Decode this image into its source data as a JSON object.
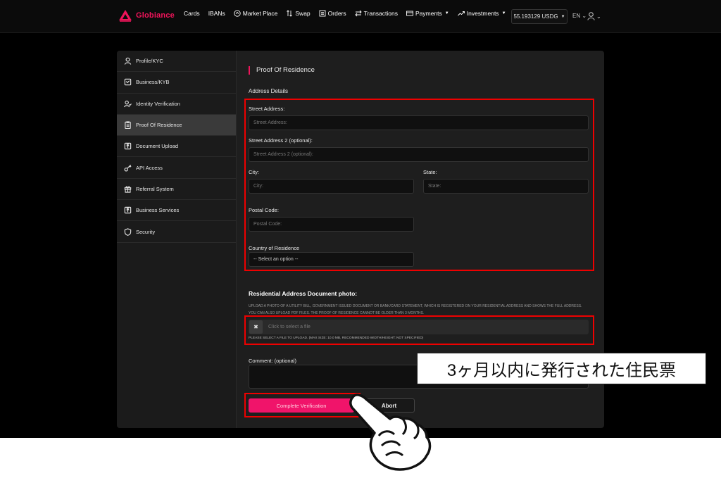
{
  "brand": {
    "name": "Globiance",
    "accent": "#f0145a"
  },
  "nav": {
    "items": [
      {
        "label": "Cards",
        "icon": ""
      },
      {
        "label": "IBANs",
        "icon": ""
      },
      {
        "label": "Market Place",
        "icon": "marketplace-icon"
      },
      {
        "label": "Swap",
        "icon": "swap-icon"
      },
      {
        "label": "Orders",
        "icon": "orders-icon"
      },
      {
        "label": "Transactions",
        "icon": "transactions-icon"
      },
      {
        "label": "Payments",
        "icon": "payments-icon",
        "dropdown": true
      },
      {
        "label": "Investments",
        "icon": "investments-icon",
        "dropdown": true
      }
    ],
    "balance": "55.193129 USDG",
    "language": "EN"
  },
  "sidebar": {
    "items": [
      {
        "label": "Profile/KYC",
        "icon": "user-icon"
      },
      {
        "label": "Business/KYB",
        "icon": "briefcase-icon"
      },
      {
        "label": "Identity Verification",
        "icon": "user-check-icon"
      },
      {
        "label": "Proof Of Residence",
        "icon": "clipboard-icon",
        "active": true
      },
      {
        "label": "Document Upload",
        "icon": "upload-icon"
      },
      {
        "label": "API Access",
        "icon": "key-icon"
      },
      {
        "label": "Referral System",
        "icon": "gift-icon"
      },
      {
        "label": "Business Services",
        "icon": "business-upload-icon"
      },
      {
        "label": "Security",
        "icon": "shield-icon"
      }
    ]
  },
  "form": {
    "title": "Proof Of Residence",
    "address_details": "Address Details",
    "street": {
      "label": "Street Address:",
      "placeholder": "Street Address:"
    },
    "street2": {
      "label": "Street Address 2 (optional):",
      "placeholder": "Street Address 2 (optional):"
    },
    "city": {
      "label": "City:",
      "placeholder": "City:"
    },
    "state": {
      "label": "State:",
      "placeholder": "State:"
    },
    "postal": {
      "label": "Postal Code:",
      "placeholder": "Postal Code:"
    },
    "country": {
      "label": "Country of Residence",
      "selected": "-- Select an option --"
    },
    "doc": {
      "title": "Residential Address Document photo:",
      "description": "Upload a photo of a utility bill, government issued document or bank/card statement, which is registered on your residential address and shows the full address. You can also upload PDF files. The proof of residence cannot be older than 3 months.",
      "file_placeholder": "Click to select a file",
      "clear_icon": "✖",
      "hint": "Please select a file to upload. (Max size: 10.0 MB, Recommended width/height: not specified)"
    },
    "comment": {
      "label": "Comment: (optional)"
    },
    "complete_label": "Complete Verification",
    "abort_label": "Abort"
  },
  "annotation": {
    "callout": "3ヶ月以内に発行された住民票"
  }
}
